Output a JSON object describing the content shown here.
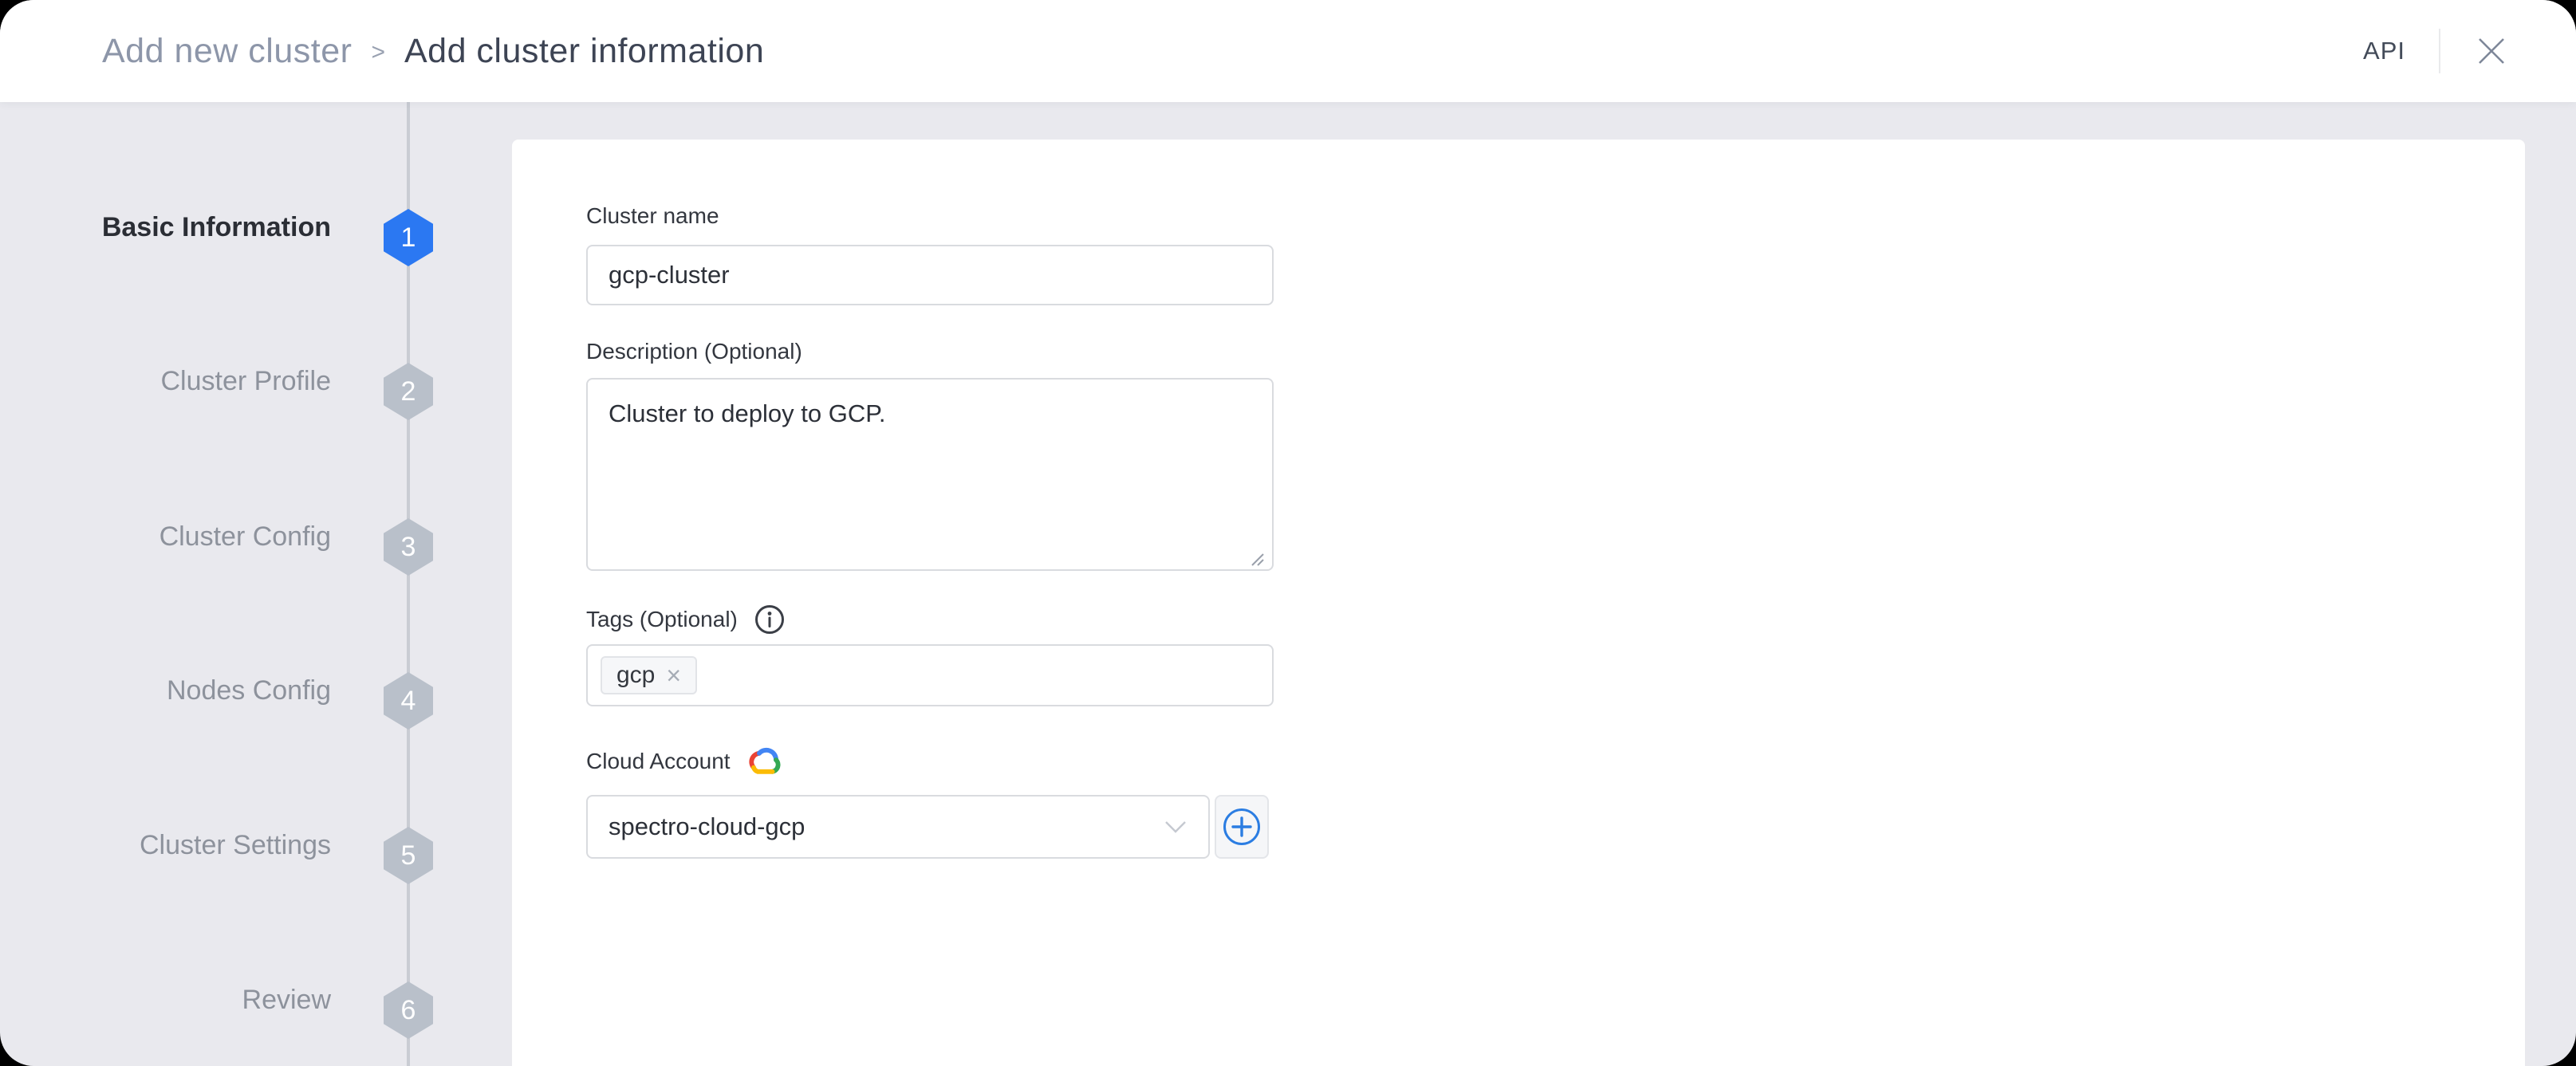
{
  "header": {
    "breadcrumb": {
      "parent": "Add new cluster",
      "separator": ">",
      "current": "Add cluster information"
    },
    "api_label": "API"
  },
  "stepper": {
    "steps": [
      {
        "number": "1",
        "label": "Basic Information",
        "state": "active"
      },
      {
        "number": "2",
        "label": "Cluster Profile",
        "state": "upcoming"
      },
      {
        "number": "3",
        "label": "Cluster Config",
        "state": "upcoming"
      },
      {
        "number": "4",
        "label": "Nodes Config",
        "state": "upcoming"
      },
      {
        "number": "5",
        "label": "Cluster Settings",
        "state": "upcoming"
      },
      {
        "number": "6",
        "label": "Review",
        "state": "upcoming"
      }
    ]
  },
  "form": {
    "cluster_name": {
      "label": "Cluster name",
      "value": "gcp-cluster"
    },
    "description": {
      "label": "Description (Optional)",
      "value": "Cluster to deploy to GCP."
    },
    "tags": {
      "label": "Tags (Optional)",
      "chips": [
        {
          "text": "gcp"
        }
      ]
    },
    "cloud_account": {
      "label": "Cloud Account",
      "selected": "spectro-cloud-gcp"
    }
  },
  "icons": {
    "close": "close-icon",
    "info": "info-circle-icon",
    "cloud_provider": "gcp-cloud-icon",
    "chip_remove": "×",
    "dropdown": "chevron-down-icon",
    "add_account": "plus-circle-icon"
  },
  "colors": {
    "accent_blue": "#2b78f2",
    "inactive_step": "#b9c0ca",
    "backdrop_gray": "#e9e9ee",
    "gcp_red": "#EA4335",
    "gcp_blue": "#4285F4",
    "gcp_yellow": "#FBBC05",
    "gcp_green": "#34A853"
  }
}
